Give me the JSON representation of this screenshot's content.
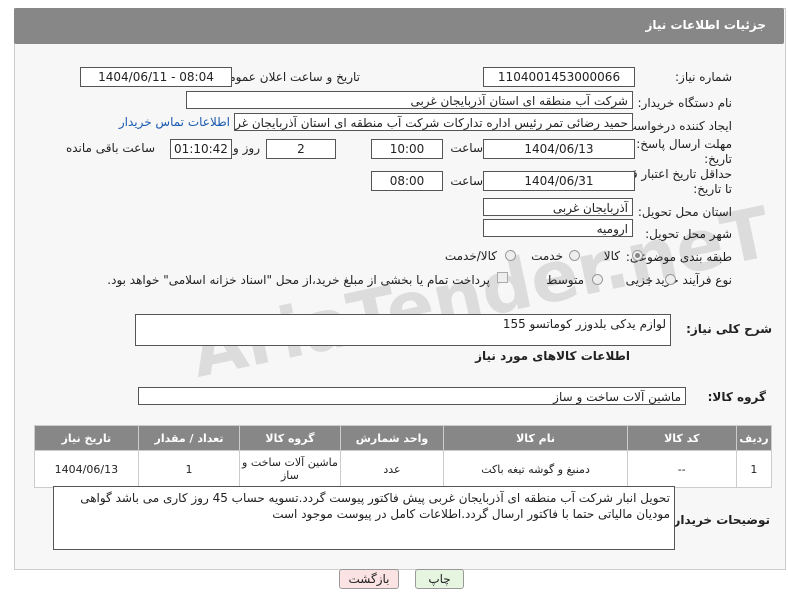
{
  "header": {
    "title": "جزئیات اطلاعات نیاز"
  },
  "fields": {
    "need_number_label": "شماره نیاز:",
    "need_number": "1104001453000066",
    "announce_label": "تاریخ و ساعت اعلان عمومی:",
    "announce_value": "1404/06/11 - 08:04",
    "buyer_org_label": "نام دستگاه خریدار:",
    "buyer_org": "شرکت آب منطقه ای استان آذربایجان غربی",
    "creator_label": "ایجاد کننده درخواست:",
    "creator": "حمید رضائی تمر رئیس اداره تدارکات شرکت آب منطقه ای استان آذربایجان غربی",
    "contact_link": "اطلاعات تماس خریدار",
    "reply_deadline_label_1": "مهلت ارسال پاسخ: تا",
    "reply_deadline_label_2": "تاریخ:",
    "reply_date": "1404/06/13",
    "time_label": "ساعت",
    "reply_time": "10:00",
    "days_value": "2",
    "days_label": "روز و",
    "remaining_value": "01:10:42",
    "remaining_label": "ساعت باقی مانده",
    "price_validity_label_1": "حداقل تاریخ اعتبار قیمت:",
    "price_validity_label_2": "تا تاریخ:",
    "price_date": "1404/06/31",
    "price_time": "08:00",
    "province_label": "استان محل تحویل:",
    "province": "آذربایجان غربی",
    "city_label": "شهر محل تحویل:",
    "city": "ارومیه",
    "category_label": "طبقه بندی موضوعی:",
    "cat_goods": "کالا",
    "cat_service": "خدمت",
    "cat_goods_service": "کالا/خدمت",
    "process_label": "نوع فرآیند خرید :",
    "proc_minor": "جزیی",
    "proc_medium": "متوسط",
    "payment_note": "پرداخت تمام یا بخشی از مبلغ خرید،از محل \"اسناد خزانه اسلامی\" خواهد بود."
  },
  "description": {
    "label": "شرح کلی نیاز:",
    "value": "لوازم یدکی بلدوزر کوماتسو 155"
  },
  "goods_section": {
    "title": "اطلاعات کالاهای مورد نیاز",
    "group_label": "گروه کالا:",
    "group_value": "ماشین آلات ساخت و ساز"
  },
  "table": {
    "headers": [
      "ردیف",
      "کد کالا",
      "نام کالا",
      "واحد شمارش",
      "گروه کالا",
      "تعداد / مقدار",
      "تاریخ نیاز"
    ],
    "rows": [
      [
        "1",
        "--",
        "دمنبغ و گوشه تیغه باکت",
        "عدد",
        "ماشین آلات ساخت و ساز",
        "1",
        "1404/06/13"
      ]
    ]
  },
  "buyer_notes": {
    "label": "توضیحات خریدار:",
    "line1": "تحویل انبار شرکت آب منطقه ای آذربایجان غربی پیش فاکتور پیوست گردد.تسویه حساب 45 روز کاری می باشد گواهی",
    "line2": "مودیان مالیاتی حتما با فاکتور ارسال گردد.اطلاعات کامل در پیوست موجود است"
  },
  "buttons": {
    "print": "چاپ",
    "back": "بازگشت"
  },
  "watermark": "AriaTender.neT",
  "colors": {
    "header": "#878787",
    "link": "#1a5ab0",
    "print_btn": "#e6f5e0",
    "back_btn": "#fbe3e3"
  }
}
